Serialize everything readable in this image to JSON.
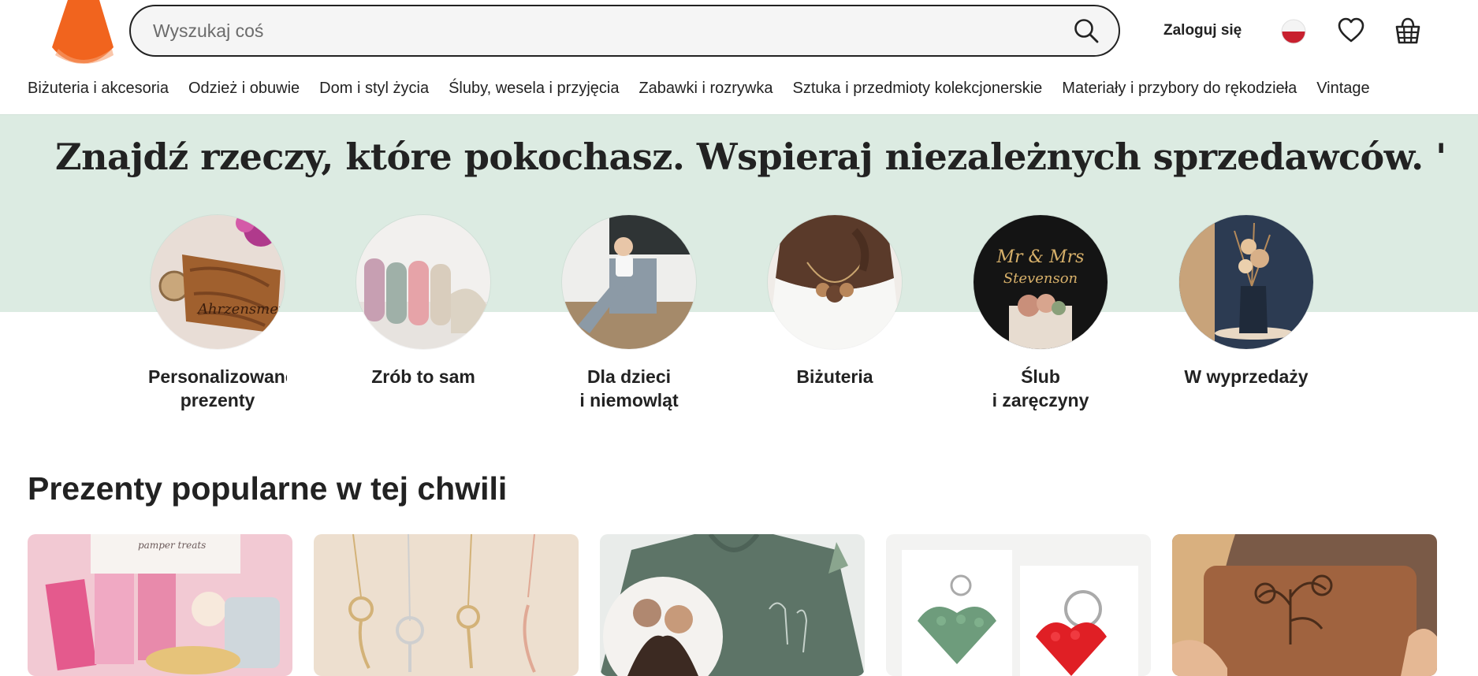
{
  "header": {
    "logo_icon": "etsy-orange-logo-icon",
    "search": {
      "placeholder": "Wyszukaj coś",
      "value": "",
      "icon": "search-icon"
    },
    "login_label": "Zaloguj się",
    "flag_icon": "poland-flag-icon",
    "favorites_icon": "heart-icon",
    "cart_icon": "shopping-basket-icon"
  },
  "categories": [
    "Biżuteria i akcesoria",
    "Odzież i obuwie",
    "Dom i styl życia",
    "Śluby, wesela i przyjęcia",
    "Zabawki i rozrywka",
    "Sztuka i przedmioty kolekcjonerskie",
    "Materiały i przybory do rękodzieła",
    "Vintage"
  ],
  "hero": {
    "title": "Znajdź rzeczy, które pokochasz. Wspieraj niezależnych sprzedawców. '",
    "band_color": "#dcebe2",
    "circles": [
      {
        "label": "Personalizowane\nprezenty"
      },
      {
        "label": "Zrób to sam"
      },
      {
        "label": "Dla dzieci\ni niemowląt"
      },
      {
        "label": "Biżuteria"
      },
      {
        "label": "Ślub\ni zaręczyny"
      },
      {
        "label": "W wyprzedaży"
      }
    ]
  },
  "popular": {
    "title": "Prezenty popularne w tej chwili",
    "cards": [
      {
        "alt": "pamper treats"
      },
      {
        "alt": ""
      },
      {
        "alt": ""
      },
      {
        "alt": ""
      },
      {
        "alt": ""
      }
    ]
  },
  "colors": {
    "accent": "#f1641e",
    "text": "#222222"
  }
}
